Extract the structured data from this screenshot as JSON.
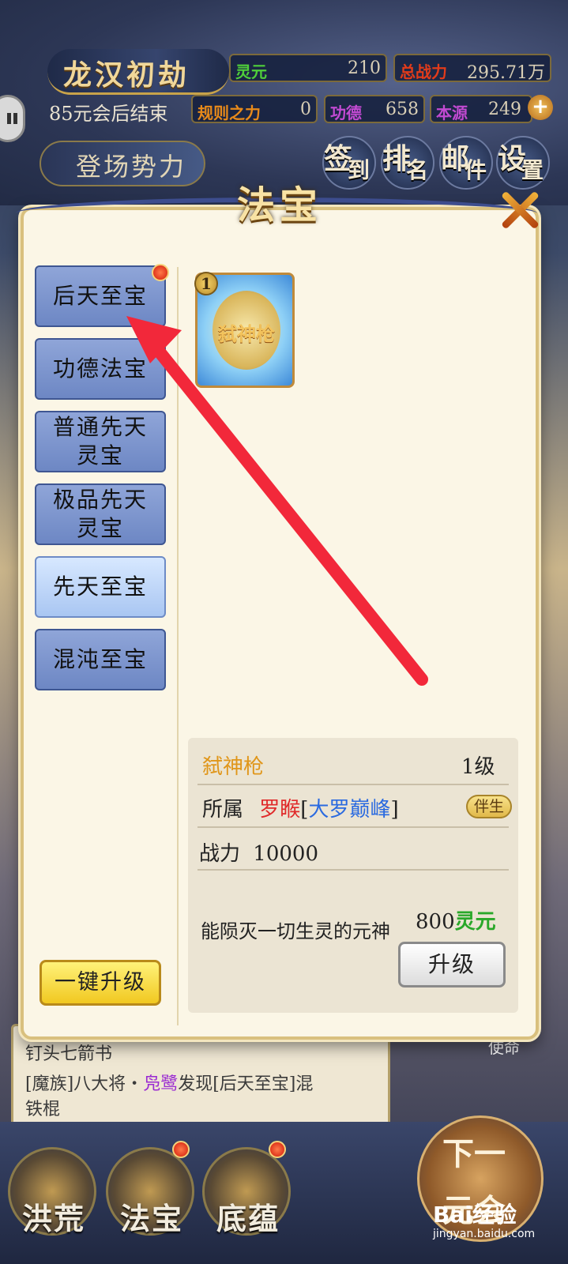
{
  "hud": {
    "title": "龙汉初劫",
    "subtitle": "85元会后结束",
    "stats": [
      {
        "label": "灵元",
        "value": "210",
        "color": "#4fcf3a"
      },
      {
        "label": "总战力",
        "value": "295.71万",
        "color": "#e23b1a"
      },
      {
        "label": "规则之力",
        "value": "0",
        "color": "#e88a1a"
      },
      {
        "label": "功德",
        "value": "658",
        "color": "#c24ad2"
      },
      {
        "label": "本源",
        "value": "249",
        "color": "#c24ad2"
      }
    ],
    "faction_button": "登场势力",
    "actions": [
      {
        "main": "签",
        "sub": "到"
      },
      {
        "main": "排",
        "sub": "名"
      },
      {
        "main": "邮",
        "sub": "件"
      },
      {
        "main": "设",
        "sub": "置"
      }
    ]
  },
  "modal": {
    "title": "法宝",
    "categories": [
      {
        "label": "后天至宝",
        "active": false,
        "has_dot": true
      },
      {
        "label": "功德法宝",
        "active": false,
        "has_dot": false
      },
      {
        "label": "普通先天灵宝",
        "active": false,
        "has_dot": false
      },
      {
        "label": "极品先天灵宝",
        "active": false,
        "has_dot": false
      },
      {
        "label": "先天至宝",
        "active": true,
        "has_dot": false
      },
      {
        "label": "混沌至宝",
        "active": false,
        "has_dot": false
      }
    ],
    "treasure": {
      "name": "弑神枪",
      "level_badge": "1"
    },
    "detail": {
      "name": "弑神枪",
      "level": "1级",
      "owner_label": "所属",
      "owner_name": "罗睺",
      "owner_bracket_open": "[",
      "owner_faction": "大罗巅峰",
      "owner_bracket_close": "]",
      "buddy_badge": "伴生",
      "power_label": "战力",
      "power_value": "10000",
      "description": "能陨灭一切生灵的元神",
      "cost_amount": "800",
      "cost_unit": "灵元",
      "upgrade_label": "升级"
    },
    "one_key_upgrade": "一键升级"
  },
  "log": {
    "line1": "钉头七箭书",
    "line2_prefix": "[魔族]八大将・",
    "line2_name": "凫鹭",
    "line2_suffix": "发现[后天至宝]混",
    "line3": "铁棍",
    "mission_tag": "使命"
  },
  "bottom_nav": [
    {
      "label": "洪荒",
      "has_dot": false
    },
    {
      "label": "法宝",
      "has_dot": true
    },
    {
      "label": "底蕴",
      "has_dot": true
    }
  ],
  "next_button": {
    "line1": "下一",
    "line2": "元会"
  },
  "watermark": {
    "main": "Bai经验",
    "sub": "jingyan.baidu.com"
  }
}
